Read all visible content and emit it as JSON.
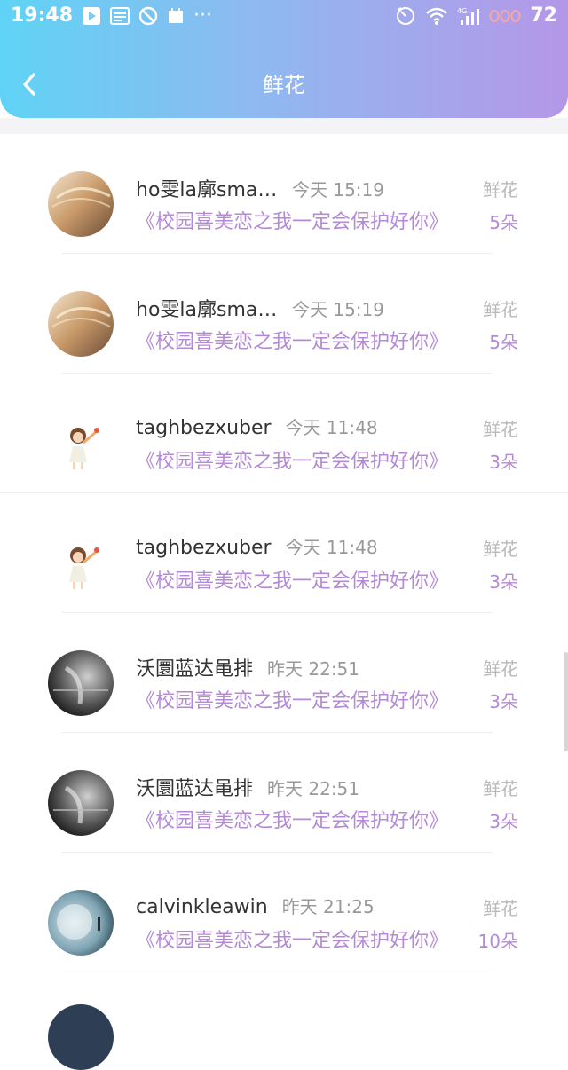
{
  "status_bar": {
    "time": "19:48",
    "left_icons": [
      "play-icon",
      "news-icon",
      "blocked-icon",
      "calendar-icon"
    ],
    "more": "···",
    "right_icons": [
      "timer-icon",
      "wifi-icon",
      "signal-icon"
    ],
    "signal_type": "4G",
    "battery": "72"
  },
  "header": {
    "title": "鲜花",
    "back_icon": "chevron-left-icon"
  },
  "list": [
    {
      "username": "ho雯la廓smar…",
      "time": "今天 15:19",
      "work": "《校园喜美恋之我一定会保护好你》",
      "gift_label": "鲜花",
      "gift_count": "5朵",
      "avatar": "warm-hair"
    },
    {
      "username": "ho雯la廓smar…",
      "time": "今天 15:19",
      "work": "《校园喜美恋之我一定会保护好你》",
      "gift_label": "鲜花",
      "gift_count": "5朵",
      "avatar": "warm-hair"
    },
    {
      "username": "taghbezxuber",
      "time": "今天 11:48",
      "work": "《校园喜美恋之我一定会保护好你》",
      "gift_label": "鲜花",
      "gift_count": "3朵",
      "avatar": "cartoon-girl"
    },
    {
      "username": "taghbezxuber",
      "time": "今天 11:48",
      "work": "《校园喜美恋之我一定会保护好你》",
      "gift_label": "鲜花",
      "gift_count": "3朵",
      "avatar": "cartoon-girl"
    },
    {
      "username": "沃圜蓝达黾排",
      "time": "昨天 22:51",
      "work": "《校园喜美恋之我一定会保护好你》",
      "gift_label": "鲜花",
      "gift_count": "3朵",
      "avatar": "monochrome"
    },
    {
      "username": "沃圜蓝达黾排",
      "time": "昨天 22:51",
      "work": "《校园喜美恋之我一定会保护好你》",
      "gift_label": "鲜花",
      "gift_count": "3朵",
      "avatar": "monochrome"
    },
    {
      "username": "calvinkleawin",
      "time": "昨天 21:25",
      "work": "《校园喜美恋之我一定会保护好你》",
      "gift_label": "鲜花",
      "gift_count": "10朵",
      "avatar": "moon"
    }
  ],
  "colors": {
    "header_gradient_start": "#5fd3f5",
    "header_gradient_end": "#b597e8",
    "accent_purple": "#b48ad8",
    "muted_gray": "#999999"
  }
}
